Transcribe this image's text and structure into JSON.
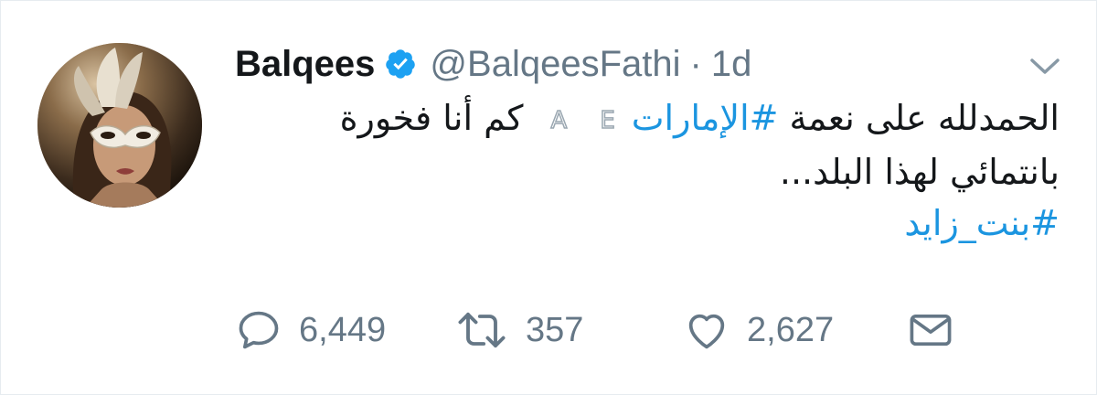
{
  "tweet": {
    "display_name": "Balqees",
    "handle": "@BalqeesFathi",
    "separator": "·",
    "time": "1d",
    "verified_icon": "verified-badge-icon",
    "menu_icon": "chevron-down-icon",
    "body": {
      "line1_text_a": "الحمدلله على نعمة ",
      "line1_hashtag": "#الإمارات",
      "line1_flag_1": "A",
      "line1_flag_2": "E",
      "line1_text_b": " كم أنا فخورة",
      "line2_text": "بانتمائي لهذا البلد...",
      "line3_hashtag": "#بنت_زايد"
    },
    "actions": {
      "reply_count": "6,449",
      "retweet_count": "357",
      "like_count": "2,627"
    }
  },
  "colors": {
    "text_primary": "#14171a",
    "text_secondary": "#657786",
    "link": "#1b95e0",
    "verified": "#1da1f2"
  }
}
